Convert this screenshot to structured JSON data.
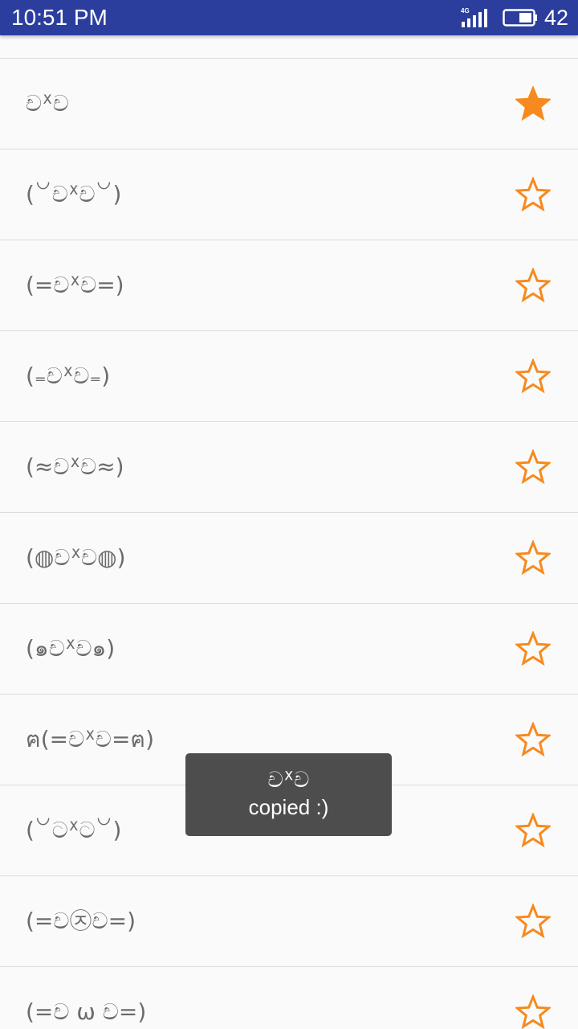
{
  "status_bar": {
    "time": "10:51 PM",
    "network": "4G",
    "battery_level": "42",
    "icons": [
      "signal-4g-icon",
      "battery-icon"
    ]
  },
  "list": {
    "items": [
      {
        "text": "චᕽච",
        "favorite": true
      },
      {
        "text": "(꒡චᕽච꒡)",
        "favorite": false
      },
      {
        "text": "(=චᕽච=)",
        "favorite": false
      },
      {
        "text": "(₌චᕽච₌)",
        "favorite": false
      },
      {
        "text": "(≈චᕽච≈)",
        "favorite": false
      },
      {
        "text": "(◍චᕽච◍)",
        "favorite": false
      },
      {
        "text": "(๑චᕽච๑)",
        "favorite": false
      },
      {
        "text": "ฅ(=චᕽච=ฅ)",
        "favorite": false
      },
      {
        "text": "(꒡ටᕽට꒡)",
        "favorite": false
      },
      {
        "text": "(=ච㉨ච=)",
        "favorite": false
      },
      {
        "text": "(=ච ω ච=)",
        "favorite": false
      }
    ]
  },
  "toast": {
    "line1": "චᕽච",
    "line2": "copied :)"
  },
  "colors": {
    "status_bar": "#2b3e9e",
    "star": "#f68a1e",
    "toast": "#4d4d4d",
    "text": "#6b6b6b"
  }
}
